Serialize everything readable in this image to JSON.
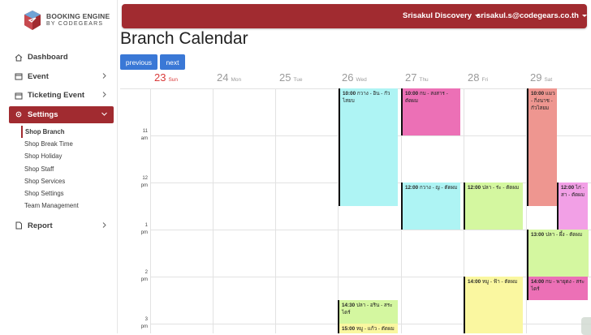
{
  "brand": {
    "title": "BOOKING ENGINE",
    "subtitle": "BY CODEGEARS",
    "color": "#a12b30"
  },
  "nav": [
    {
      "label": "Dashboard",
      "icon": "home-icon"
    },
    {
      "label": "Event",
      "icon": "calendar-icon",
      "chevron": "chevron-right-icon"
    },
    {
      "label": "Ticketing Event",
      "icon": "calendar-icon",
      "chevron": "chevron-right-icon"
    },
    {
      "label": "Settings",
      "icon": "gear-icon",
      "chevron": "chevron-down-icon",
      "active": true
    },
    {
      "label": "Report",
      "icon": "document-icon",
      "chevron": "chevron-right-icon"
    }
  ],
  "settings_sub": [
    "Shop Branch",
    "Shop Break Time",
    "Shop Holiday",
    "Shop Staff",
    "Shop Services",
    "Shop Settings",
    "Team Management"
  ],
  "topbar": {
    "branch": "Srisakul Discovery",
    "user": "srisakul.s@codegears.co.th"
  },
  "page_title": "Branch Calendar",
  "buttons": {
    "previous": "previous",
    "next": "next"
  },
  "days": [
    {
      "num": "23",
      "wd": "Sun"
    },
    {
      "num": "24",
      "wd": "Mon"
    },
    {
      "num": "25",
      "wd": "Tue"
    },
    {
      "num": "26",
      "wd": "Wed"
    },
    {
      "num": "27",
      "wd": "Thu"
    },
    {
      "num": "28",
      "wd": "Fri"
    },
    {
      "num": "29",
      "wd": "Sat"
    }
  ],
  "times": [
    {
      "h": "11",
      "ap": "am"
    },
    {
      "h": "12",
      "ap": "pm"
    },
    {
      "h": "1",
      "ap": "pm"
    },
    {
      "h": "2",
      "ap": "pm"
    },
    {
      "h": "3",
      "ap": "pm"
    }
  ],
  "events": [
    {
      "time": "10:00",
      "text": "กวาง - อิน - กัวไสยบ",
      "color": "#aef4f4"
    },
    {
      "time": "10:00",
      "text": "กบ - สงสาร - ตัดผม",
      "color": "#ec70b6"
    },
    {
      "time": "10:00",
      "text": "แมว - กิ่งนาช - กัวไสยม",
      "color": "#ee9690"
    },
    {
      "time": "12:00",
      "text": "กวาง - ญ - ตัดผม",
      "color": "#aef4f4"
    },
    {
      "time": "12:00",
      "text": "ปลา - ร่ะ - ตัดผม",
      "color": "#d4f7a0"
    },
    {
      "time": "12:00",
      "text": "ไก่ - สา - ตัดผม",
      "color": "#f2a0e6"
    },
    {
      "time": "13:00",
      "text": "ปลา - ผึ้ง - ตัดผม",
      "color": "#d4f7a0"
    },
    {
      "time": "14:00",
      "text": "กบ - พายุดง - สระไดร์",
      "color": "#ec70b6"
    },
    {
      "time": "14:00",
      "text": "หมู - ฟ้า - ตัดผม",
      "color": "#faf7a0"
    },
    {
      "time": "14:30",
      "text": "ปลา - อริน - สระไดร์",
      "color": "#d4f7a0"
    },
    {
      "time": "15:00",
      "text": "หมู - แก้ว - ตัดผม",
      "color": "#faf7a0"
    }
  ]
}
